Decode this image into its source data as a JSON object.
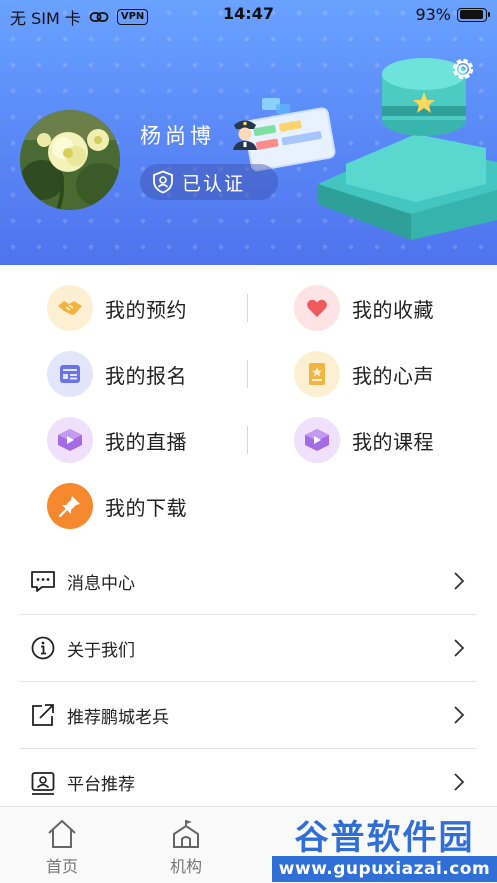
{
  "status_bar": {
    "carrier": "无 SIM 卡",
    "vpn": "VPN",
    "time": "14:47",
    "battery": "93%",
    "battery_level": 0.93
  },
  "profile": {
    "name": "杨尚博",
    "verified_label": "已认证",
    "settings_icon": "gear-icon"
  },
  "grid": {
    "rows": [
      [
        {
          "label": "我的预约",
          "icon": "handshake-icon",
          "bg": "#fdefd2",
          "color": "#f2b441"
        },
        {
          "label": "我的收藏",
          "icon": "heart-icon",
          "bg": "#fde3e3",
          "color": "#ef5a5a"
        }
      ],
      [
        {
          "label": "我的报名",
          "icon": "form-icon",
          "bg": "#e3e6fb",
          "color": "#6a74e6"
        },
        {
          "label": "我的心声",
          "icon": "note-icon",
          "bg": "#fdefd2",
          "color": "#f2b441"
        }
      ],
      [
        {
          "label": "我的直播",
          "icon": "live-icon",
          "bg": "#efe1fb",
          "color": "#a56be6"
        },
        {
          "label": "我的课程",
          "icon": "course-icon",
          "bg": "#efe1fb",
          "color": "#a56be6"
        }
      ],
      [
        {
          "label": "我的下载",
          "icon": "download-pin-icon",
          "bg": "#f6882e",
          "color": "#ffffff"
        }
      ]
    ]
  },
  "list": [
    {
      "label": "消息中心",
      "icon": "message-icon"
    },
    {
      "label": "关于我们",
      "icon": "info-icon"
    },
    {
      "label": "推荐鹏城老兵",
      "icon": "share-icon"
    },
    {
      "label": "平台推荐",
      "icon": "contact-icon"
    }
  ],
  "tabs": [
    {
      "label": "首页",
      "icon": "home-icon"
    },
    {
      "label": "机构",
      "icon": "organization-icon"
    }
  ],
  "watermark": {
    "title": "谷普软件园",
    "url": "www.gupuxiazai.com"
  },
  "colors": {
    "header_top": "#6aa2ff",
    "header_bottom": "#4f73ee",
    "watermark_blue": "#2f6fd6"
  }
}
